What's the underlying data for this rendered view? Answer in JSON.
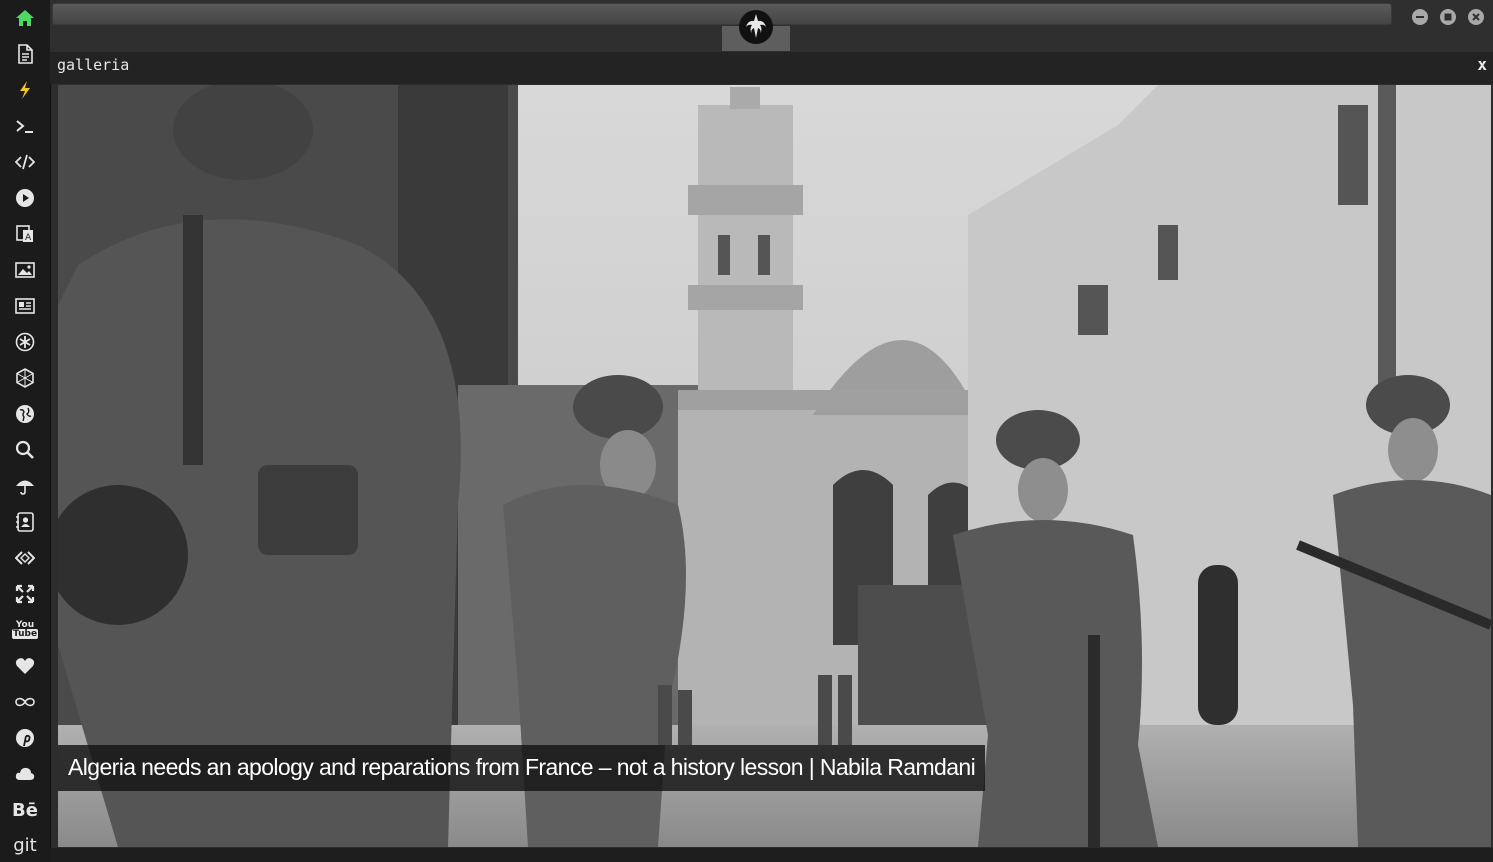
{
  "window": {
    "controls": [
      "minimize",
      "maximize",
      "close"
    ]
  },
  "sidebar": {
    "items": [
      {
        "icon": "home-icon",
        "active": true
      },
      {
        "icon": "document-icon"
      },
      {
        "icon": "lightning-icon"
      },
      {
        "icon": "terminal-icon"
      },
      {
        "icon": "code-icon"
      },
      {
        "icon": "play-icon"
      },
      {
        "icon": "translate-icon"
      },
      {
        "icon": "image-icon"
      },
      {
        "icon": "newspaper-icon"
      },
      {
        "icon": "asterisk-icon"
      },
      {
        "icon": "hexagon-icon"
      },
      {
        "icon": "globe-icon"
      },
      {
        "icon": "search-icon"
      },
      {
        "icon": "umbrella-icon"
      },
      {
        "icon": "contact-icon"
      },
      {
        "icon": "diamond-code-icon"
      },
      {
        "icon": "expand-icon"
      },
      {
        "icon": "youtube-icon",
        "label": "You\nTube"
      },
      {
        "icon": "heart-icon"
      },
      {
        "icon": "infinity-icon"
      },
      {
        "icon": "pinterest-icon"
      },
      {
        "icon": "cloud-icon"
      },
      {
        "icon": "behance-icon",
        "label": "Bē"
      },
      {
        "icon": "git-icon",
        "label": "git"
      }
    ],
    "accent": "#4cd964"
  },
  "panel": {
    "title": "galleria",
    "close_label": "x"
  },
  "gallery": {
    "caption": "Algeria needs an apology and reparations from France – not a history lesson | Nabila Ramdani",
    "image_alt": "black-and-white-photo-soldiers-street-mosque"
  }
}
